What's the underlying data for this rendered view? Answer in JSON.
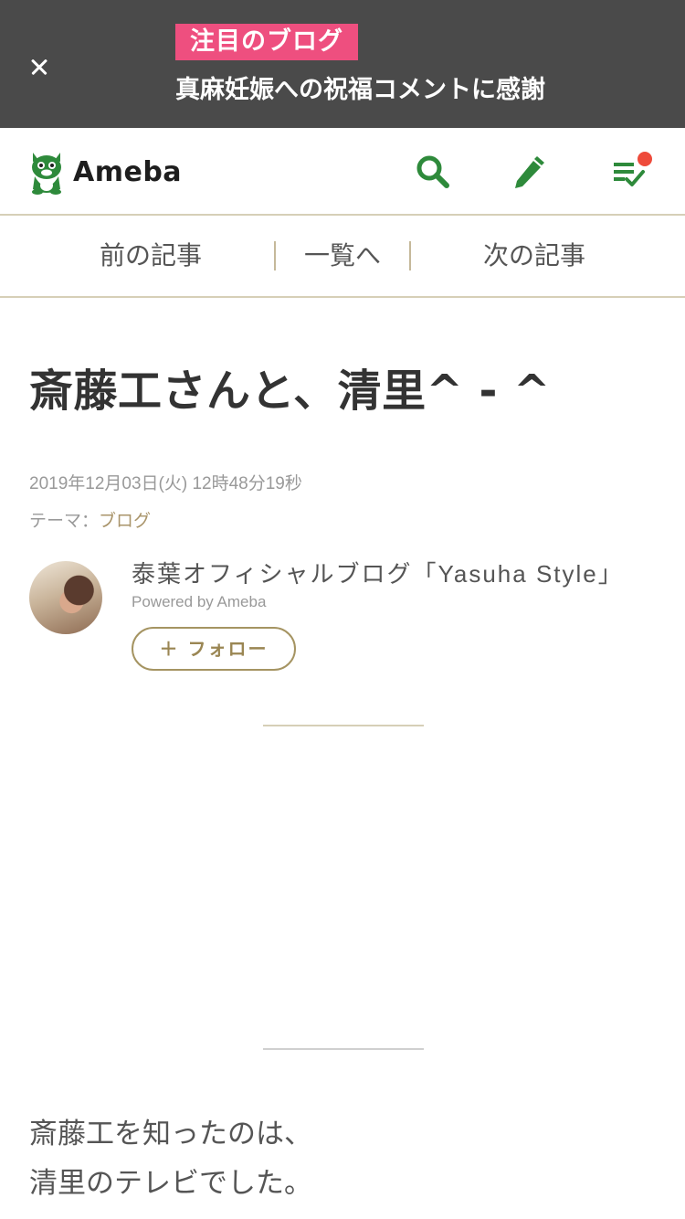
{
  "banner": {
    "badge": "注目のブログ",
    "headline": "真麻妊娠への祝福コメントに感謝"
  },
  "header": {
    "logo_text": "Ameba",
    "brand_color": "#2e8a3b",
    "notification_color": "#ee4b3b",
    "icons": [
      "search-icon",
      "edit-icon",
      "reading-list-icon"
    ]
  },
  "nav": {
    "prev": "前の記事",
    "list": "一覧へ",
    "next": "次の記事"
  },
  "article": {
    "title": "斎藤工さんと、清里^ - ^",
    "date": "2019年12月03日(火) 12時48分19秒",
    "theme_label": "テーマ：",
    "theme_value": "ブログ",
    "body_lines": [
      "斎藤工を知ったのは、",
      "清里のテレビでした。"
    ]
  },
  "author": {
    "blog_name": "泰葉オフィシャルブログ「Yasuha Style」",
    "powered_by": "Powered by Ameba",
    "follow_label": "＋ フォロー"
  }
}
